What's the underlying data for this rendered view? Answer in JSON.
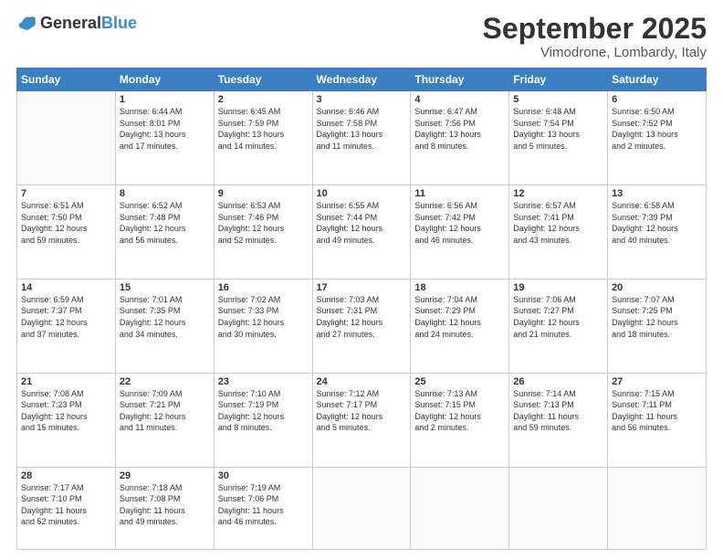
{
  "logo": {
    "general": "General",
    "blue": "Blue"
  },
  "header": {
    "month": "September 2025",
    "location": "Vimodrone, Lombardy, Italy"
  },
  "weekdays": [
    "Sunday",
    "Monday",
    "Tuesday",
    "Wednesday",
    "Thursday",
    "Friday",
    "Saturday"
  ],
  "weeks": [
    [
      {
        "day": "",
        "info": ""
      },
      {
        "day": "1",
        "info": "Sunrise: 6:44 AM\nSunset: 8:01 PM\nDaylight: 13 hours\nand 17 minutes."
      },
      {
        "day": "2",
        "info": "Sunrise: 6:45 AM\nSunset: 7:59 PM\nDaylight: 13 hours\nand 14 minutes."
      },
      {
        "day": "3",
        "info": "Sunrise: 6:46 AM\nSunset: 7:58 PM\nDaylight: 13 hours\nand 11 minutes."
      },
      {
        "day": "4",
        "info": "Sunrise: 6:47 AM\nSunset: 7:56 PM\nDaylight: 13 hours\nand 8 minutes."
      },
      {
        "day": "5",
        "info": "Sunrise: 6:48 AM\nSunset: 7:54 PM\nDaylight: 13 hours\nand 5 minutes."
      },
      {
        "day": "6",
        "info": "Sunrise: 6:50 AM\nSunset: 7:52 PM\nDaylight: 13 hours\nand 2 minutes."
      }
    ],
    [
      {
        "day": "7",
        "info": "Sunrise: 6:51 AM\nSunset: 7:50 PM\nDaylight: 12 hours\nand 59 minutes."
      },
      {
        "day": "8",
        "info": "Sunrise: 6:52 AM\nSunset: 7:48 PM\nDaylight: 12 hours\nand 56 minutes."
      },
      {
        "day": "9",
        "info": "Sunrise: 6:53 AM\nSunset: 7:46 PM\nDaylight: 12 hours\nand 52 minutes."
      },
      {
        "day": "10",
        "info": "Sunrise: 6:55 AM\nSunset: 7:44 PM\nDaylight: 12 hours\nand 49 minutes."
      },
      {
        "day": "11",
        "info": "Sunrise: 6:56 AM\nSunset: 7:42 PM\nDaylight: 12 hours\nand 46 minutes."
      },
      {
        "day": "12",
        "info": "Sunrise: 6:57 AM\nSunset: 7:41 PM\nDaylight: 12 hours\nand 43 minutes."
      },
      {
        "day": "13",
        "info": "Sunrise: 6:58 AM\nSunset: 7:39 PM\nDaylight: 12 hours\nand 40 minutes."
      }
    ],
    [
      {
        "day": "14",
        "info": "Sunrise: 6:59 AM\nSunset: 7:37 PM\nDaylight: 12 hours\nand 37 minutes."
      },
      {
        "day": "15",
        "info": "Sunrise: 7:01 AM\nSunset: 7:35 PM\nDaylight: 12 hours\nand 34 minutes."
      },
      {
        "day": "16",
        "info": "Sunrise: 7:02 AM\nSunset: 7:33 PM\nDaylight: 12 hours\nand 30 minutes."
      },
      {
        "day": "17",
        "info": "Sunrise: 7:03 AM\nSunset: 7:31 PM\nDaylight: 12 hours\nand 27 minutes."
      },
      {
        "day": "18",
        "info": "Sunrise: 7:04 AM\nSunset: 7:29 PM\nDaylight: 12 hours\nand 24 minutes."
      },
      {
        "day": "19",
        "info": "Sunrise: 7:06 AM\nSunset: 7:27 PM\nDaylight: 12 hours\nand 21 minutes."
      },
      {
        "day": "20",
        "info": "Sunrise: 7:07 AM\nSunset: 7:25 PM\nDaylight: 12 hours\nand 18 minutes."
      }
    ],
    [
      {
        "day": "21",
        "info": "Sunrise: 7:08 AM\nSunset: 7:23 PM\nDaylight: 12 hours\nand 15 minutes."
      },
      {
        "day": "22",
        "info": "Sunrise: 7:09 AM\nSunset: 7:21 PM\nDaylight: 12 hours\nand 11 minutes."
      },
      {
        "day": "23",
        "info": "Sunrise: 7:10 AM\nSunset: 7:19 PM\nDaylight: 12 hours\nand 8 minutes."
      },
      {
        "day": "24",
        "info": "Sunrise: 7:12 AM\nSunset: 7:17 PM\nDaylight: 12 hours\nand 5 minutes."
      },
      {
        "day": "25",
        "info": "Sunrise: 7:13 AM\nSunset: 7:15 PM\nDaylight: 12 hours\nand 2 minutes."
      },
      {
        "day": "26",
        "info": "Sunrise: 7:14 AM\nSunset: 7:13 PM\nDaylight: 11 hours\nand 59 minutes."
      },
      {
        "day": "27",
        "info": "Sunrise: 7:15 AM\nSunset: 7:11 PM\nDaylight: 11 hours\nand 56 minutes."
      }
    ],
    [
      {
        "day": "28",
        "info": "Sunrise: 7:17 AM\nSunset: 7:10 PM\nDaylight: 11 hours\nand 52 minutes."
      },
      {
        "day": "29",
        "info": "Sunrise: 7:18 AM\nSunset: 7:08 PM\nDaylight: 11 hours\nand 49 minutes."
      },
      {
        "day": "30",
        "info": "Sunrise: 7:19 AM\nSunset: 7:06 PM\nDaylight: 11 hours\nand 46 minutes."
      },
      {
        "day": "",
        "info": ""
      },
      {
        "day": "",
        "info": ""
      },
      {
        "day": "",
        "info": ""
      },
      {
        "day": "",
        "info": ""
      }
    ]
  ]
}
